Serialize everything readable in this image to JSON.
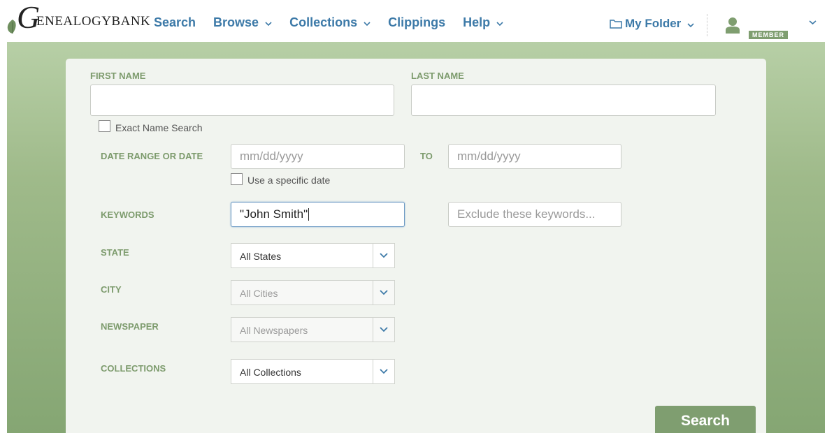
{
  "header": {
    "logo_initial": "G",
    "logo_text": "ENEALOGYBANK",
    "nav": [
      {
        "label": "Search",
        "has_dropdown": false
      },
      {
        "label": "Browse",
        "has_dropdown": true
      },
      {
        "label": "Collections",
        "has_dropdown": true
      },
      {
        "label": "Clippings",
        "has_dropdown": false
      },
      {
        "label": "Help",
        "has_dropdown": true
      }
    ],
    "my_folder": "My Folder",
    "member_badge": "MEMBER"
  },
  "form": {
    "first_name": {
      "label": "FIRST NAME",
      "value": ""
    },
    "last_name": {
      "label": "LAST NAME",
      "value": ""
    },
    "exact_name": {
      "label": "Exact Name Search",
      "checked": false
    },
    "date_range": {
      "label": "DATE RANGE OR DATE",
      "from_placeholder": "mm/dd/yyyy",
      "to_label": "TO",
      "to_placeholder": "mm/dd/yyyy"
    },
    "specific_date": {
      "label": "Use a specific date",
      "checked": false
    },
    "keywords": {
      "label": "KEYWORDS",
      "value": "\"John Smith\"",
      "exclude_placeholder": "Exclude these keywords..."
    },
    "state": {
      "label": "STATE",
      "value": "All States"
    },
    "city": {
      "label": "CITY",
      "value": "All Cities"
    },
    "newspaper": {
      "label": "NEWSPAPER",
      "value": "All Newspapers"
    },
    "collections": {
      "label": "COLLECTIONS",
      "value": "All Collections"
    },
    "search_button": "Search"
  },
  "colors": {
    "nav_blue": "#3d7aa8",
    "label_green": "#7d9b6d",
    "button_green": "#7f9e70",
    "panel_bg": "#f1f4ef"
  }
}
